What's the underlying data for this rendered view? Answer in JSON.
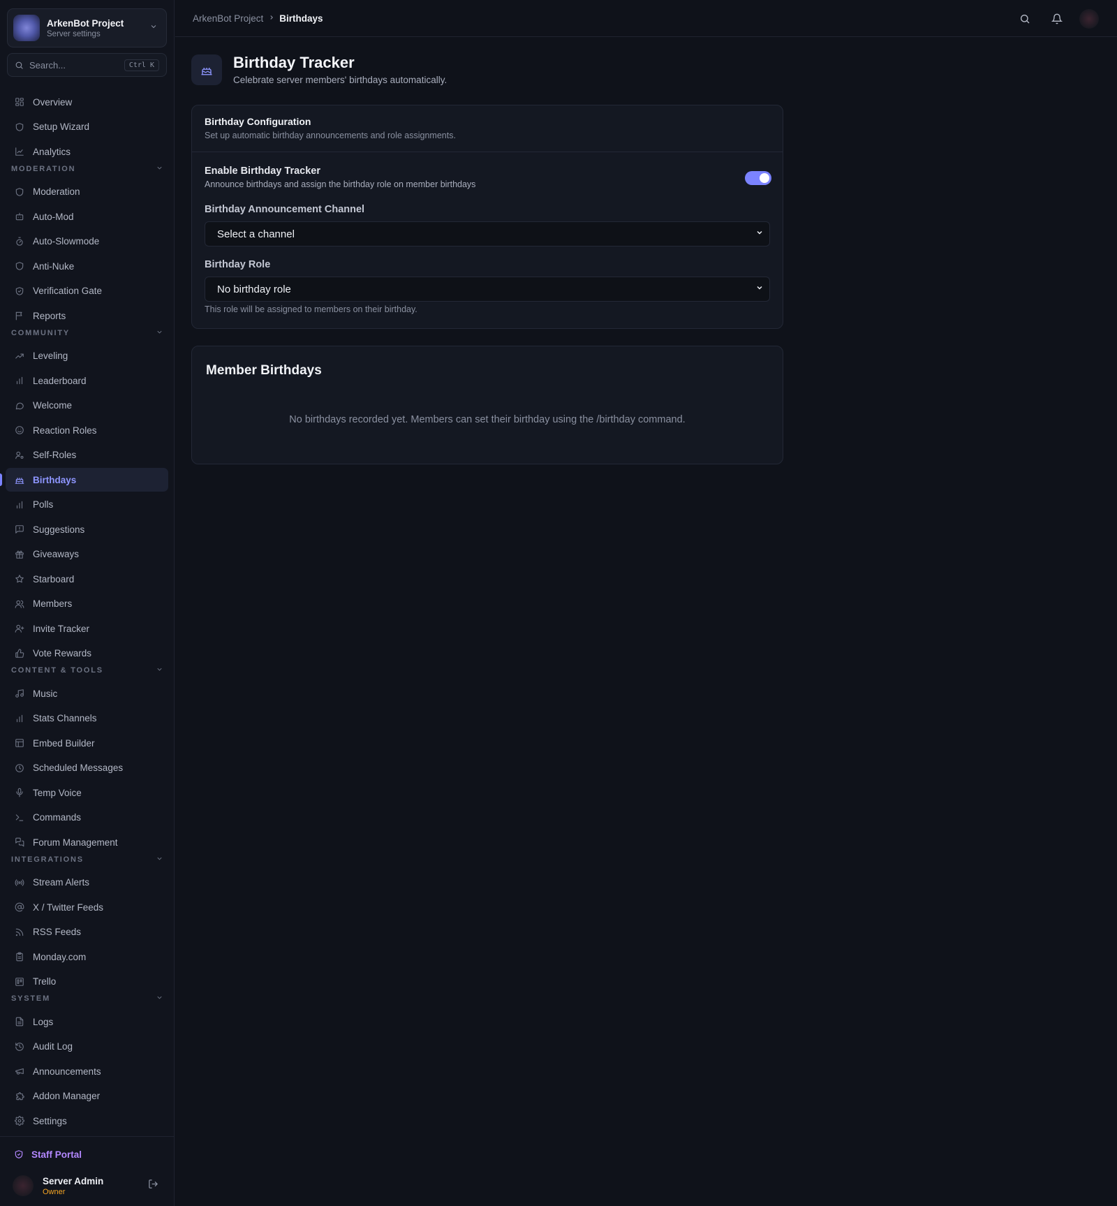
{
  "server": {
    "name": "ArkenBot Project",
    "subtitle": "Server settings"
  },
  "search": {
    "placeholder": "Search...",
    "shortcut": "Ctrl K"
  },
  "nav": {
    "top": [
      {
        "label": "Overview",
        "icon": "dashboard-icon"
      },
      {
        "label": "Setup Wizard",
        "icon": "shield-icon"
      },
      {
        "label": "Analytics",
        "icon": "chart-line-icon"
      }
    ],
    "sections": [
      {
        "title": "MODERATION",
        "items": [
          {
            "label": "Moderation",
            "icon": "shield-icon"
          },
          {
            "label": "Auto-Mod",
            "icon": "bot-icon"
          },
          {
            "label": "Auto-Slowmode",
            "icon": "timer-icon"
          },
          {
            "label": "Anti-Nuke",
            "icon": "shield-icon"
          },
          {
            "label": "Verification Gate",
            "icon": "shield-check-icon"
          },
          {
            "label": "Reports",
            "icon": "flag-icon"
          }
        ]
      },
      {
        "title": "COMMUNITY",
        "items": [
          {
            "label": "Leveling",
            "icon": "trending-up-icon"
          },
          {
            "label": "Leaderboard",
            "icon": "bar-chart-icon"
          },
          {
            "label": "Welcome",
            "icon": "message-icon"
          },
          {
            "label": "Reaction Roles",
            "icon": "smile-icon"
          },
          {
            "label": "Self-Roles",
            "icon": "user-cog-icon"
          },
          {
            "label": "Birthdays",
            "icon": "cake-icon",
            "active": true
          },
          {
            "label": "Polls",
            "icon": "bar-chart-icon"
          },
          {
            "label": "Suggestions",
            "icon": "message-square-icon"
          },
          {
            "label": "Giveaways",
            "icon": "gift-icon"
          },
          {
            "label": "Starboard",
            "icon": "star-icon"
          },
          {
            "label": "Members",
            "icon": "users-icon"
          },
          {
            "label": "Invite Tracker",
            "icon": "user-plus-icon"
          },
          {
            "label": "Vote Rewards",
            "icon": "thumbs-up-icon"
          }
        ]
      },
      {
        "title": "CONTENT & TOOLS",
        "items": [
          {
            "label": "Music",
            "icon": "music-icon"
          },
          {
            "label": "Stats Channels",
            "icon": "bar-chart-icon"
          },
          {
            "label": "Embed Builder",
            "icon": "layout-icon"
          },
          {
            "label": "Scheduled Messages",
            "icon": "clock-icon"
          },
          {
            "label": "Temp Voice",
            "icon": "mic-icon"
          },
          {
            "label": "Commands",
            "icon": "terminal-icon"
          },
          {
            "label": "Forum Management",
            "icon": "messages-icon"
          }
        ]
      },
      {
        "title": "INTEGRATIONS",
        "items": [
          {
            "label": "Stream Alerts",
            "icon": "radio-icon"
          },
          {
            "label": "X / Twitter Feeds",
            "icon": "at-sign-icon"
          },
          {
            "label": "RSS Feeds",
            "icon": "rss-icon"
          },
          {
            "label": "Monday.com",
            "icon": "clipboard-icon"
          },
          {
            "label": "Trello",
            "icon": "trello-icon"
          }
        ]
      },
      {
        "title": "SYSTEM",
        "items": [
          {
            "label": "Logs",
            "icon": "file-text-icon"
          },
          {
            "label": "Audit Log",
            "icon": "history-icon"
          },
          {
            "label": "Announcements",
            "icon": "megaphone-icon"
          },
          {
            "label": "Addon Manager",
            "icon": "puzzle-icon"
          },
          {
            "label": "Settings",
            "icon": "gear-icon"
          }
        ]
      }
    ]
  },
  "staff_portal": "Staff Portal",
  "user": {
    "name": "Server Admin",
    "role": "Owner"
  },
  "breadcrumb": {
    "parent": "ArkenBot Project",
    "current": "Birthdays"
  },
  "page": {
    "title": "Birthday Tracker",
    "subtitle": "Celebrate server members' birthdays automatically."
  },
  "config": {
    "title": "Birthday Configuration",
    "description": "Set up automatic birthday announcements and role assignments.",
    "enable_title": "Enable Birthday Tracker",
    "enable_desc": "Announce birthdays and assign the birthday role on member birthdays",
    "enabled": true,
    "channel_label": "Birthday Announcement Channel",
    "channel_value": "Select a channel",
    "role_label": "Birthday Role",
    "role_value": "No birthday role",
    "role_hint": "This role will be assigned to members on their birthday."
  },
  "members": {
    "title": "Member Birthdays",
    "empty": "No birthdays recorded yet. Members can set their birthday using the /birthday command."
  },
  "colors": {
    "accent": "#7b83ff",
    "staff": "#b388ff",
    "owner": "#f5a524"
  }
}
